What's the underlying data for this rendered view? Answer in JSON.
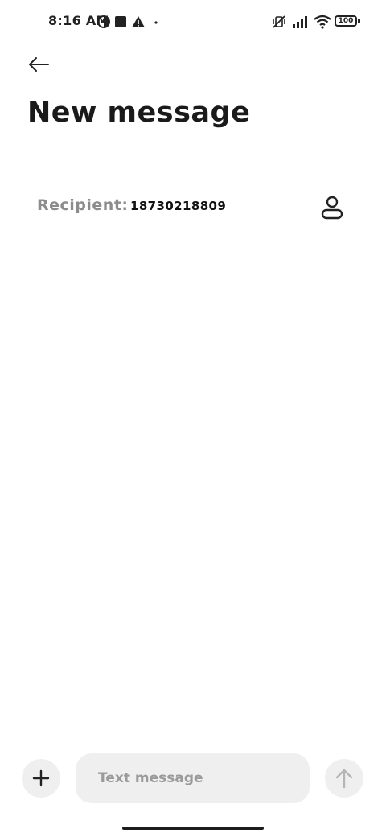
{
  "status_bar": {
    "time": "8:16 AM",
    "battery_level": "100",
    "left_icons": [
      "data-saver-icon",
      "stop-square-icon",
      "warning-icon",
      "dot-icon"
    ],
    "right_icons": [
      "vibrate-off-icon",
      "signal-icon",
      "wifi-icon",
      "battery-icon"
    ]
  },
  "header": {
    "back_icon": "arrow-left-icon",
    "title": "New message"
  },
  "recipient": {
    "label": "Recipient:",
    "value": "18730218809",
    "contact_icon": "person-icon"
  },
  "composer": {
    "attach_icon": "plus-icon",
    "placeholder": "Text message",
    "send_icon": "arrow-up-icon"
  },
  "colors": {
    "background": "#ffffff",
    "text_primary": "#1a1a1a",
    "text_muted": "#8c8c8c",
    "input_background": "#efefef",
    "divider": "#dcdcdc",
    "send_disabled": "#b5b5b5"
  }
}
